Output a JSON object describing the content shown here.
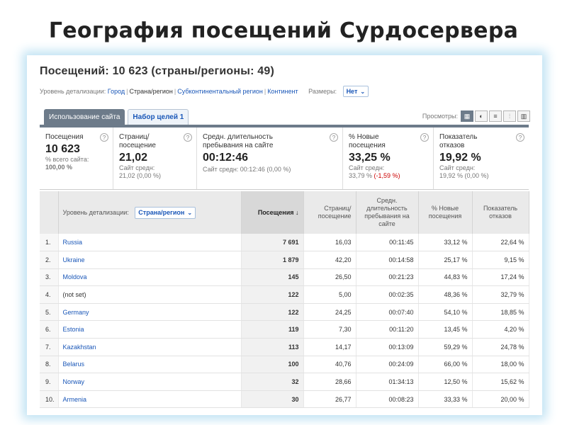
{
  "slide_title": "География посещений Сурдосервера",
  "report": {
    "header": "Посещений: 10 623 (страны/регионы: 49)",
    "detail_prefix": "Уровень детализации:",
    "detail_city": "Город",
    "detail_country": "Страна/регион",
    "detail_subcontinent": "Субконтинентальный регион",
    "detail_continent": "Континент",
    "dims_label": "Размеры:",
    "dims_value": "Нет"
  },
  "tabs": [
    {
      "label": "Использование сайта",
      "active": true
    },
    {
      "label": "Набор целей 1",
      "active": false
    }
  ],
  "views": {
    "label": "Просмотры:",
    "buttons": [
      {
        "icon": "table-icon",
        "glyph": "▦",
        "active": true
      },
      {
        "icon": "pie-icon",
        "glyph": "◐",
        "active": false
      },
      {
        "icon": "bars-icon",
        "glyph": "≡",
        "active": false
      },
      {
        "icon": "compare-icon",
        "glyph": "⫶",
        "active": false
      },
      {
        "icon": "pivot-icon",
        "glyph": "▥",
        "active": false
      }
    ]
  },
  "metrics": [
    {
      "label": "Посещения",
      "value": "10 623",
      "sub1": "% всего сайта:",
      "sub2": "100,00 %",
      "sub2_delta": ""
    },
    {
      "label": "Страниц/ посещение",
      "value": "21,02",
      "sub1": "Сайт средн:",
      "sub2": "21,02 (0,00 %)",
      "sub2_delta": ""
    },
    {
      "label": "Средн. длительность пребывания на сайте",
      "value": "00:12:46",
      "sub1": "Сайт средн: 00:12:46 (0,00 %)",
      "sub2": "",
      "sub2_delta": ""
    },
    {
      "label": "% Новые посещения",
      "value": "33,25 %",
      "sub1": "Сайт средн:",
      "sub2": "33,79 %",
      "sub2_delta": "(-1,59 %)"
    },
    {
      "label": "Показатель отказов",
      "value": "19,92 %",
      "sub1": "Сайт средн:",
      "sub2": "19,92 % (0,00 %)",
      "sub2_delta": ""
    }
  ],
  "table": {
    "detail_label": "Уровень детализации:",
    "detail_select": "Страна/регион",
    "columns": [
      "Посещения ↓",
      "Страниц/ посещение",
      "Средн. длительность пребывания на сайте",
      "% Новые посещения",
      "Показатель отказов"
    ],
    "rows": [
      {
        "idx": "1.",
        "country": "Russia",
        "visits": "7 691",
        "pages": "16,03",
        "duration": "00:11:45",
        "new_visits": "33,12 %",
        "bounce": "22,64 %"
      },
      {
        "idx": "2.",
        "country": "Ukraine",
        "visits": "1 879",
        "pages": "42,20",
        "duration": "00:14:58",
        "new_visits": "25,17 %",
        "bounce": "9,15 %"
      },
      {
        "idx": "3.",
        "country": "Moldova",
        "visits": "145",
        "pages": "26,50",
        "duration": "00:21:23",
        "new_visits": "44,83 %",
        "bounce": "17,24 %"
      },
      {
        "idx": "4.",
        "country": "(not set)",
        "visits": "122",
        "pages": "5,00",
        "duration": "00:02:35",
        "new_visits": "48,36 %",
        "bounce": "32,79 %"
      },
      {
        "idx": "5.",
        "country": "Germany",
        "visits": "122",
        "pages": "24,25",
        "duration": "00:07:40",
        "new_visits": "54,10 %",
        "bounce": "18,85 %"
      },
      {
        "idx": "6.",
        "country": "Estonia",
        "visits": "119",
        "pages": "7,30",
        "duration": "00:11:20",
        "new_visits": "13,45 %",
        "bounce": "4,20 %"
      },
      {
        "idx": "7.",
        "country": "Kazakhstan",
        "visits": "113",
        "pages": "14,17",
        "duration": "00:13:09",
        "new_visits": "59,29 %",
        "bounce": "24,78 %"
      },
      {
        "idx": "8.",
        "country": "Belarus",
        "visits": "100",
        "pages": "40,76",
        "duration": "00:24:09",
        "new_visits": "66,00 %",
        "bounce": "18,00 %"
      },
      {
        "idx": "9.",
        "country": "Norway",
        "visits": "32",
        "pages": "28,66",
        "duration": "01:34:13",
        "new_visits": "12,50 %",
        "bounce": "15,62 %"
      },
      {
        "idx": "10.",
        "country": "Armenia",
        "visits": "30",
        "pages": "26,77",
        "duration": "00:08:23",
        "new_visits": "33,33 %",
        "bounce": "20,00 %"
      }
    ]
  },
  "colors": {
    "link": "#1a57b8",
    "tab_active": "#6d7b8a",
    "negative": "#c00000",
    "glow": "#bfe2f3"
  }
}
